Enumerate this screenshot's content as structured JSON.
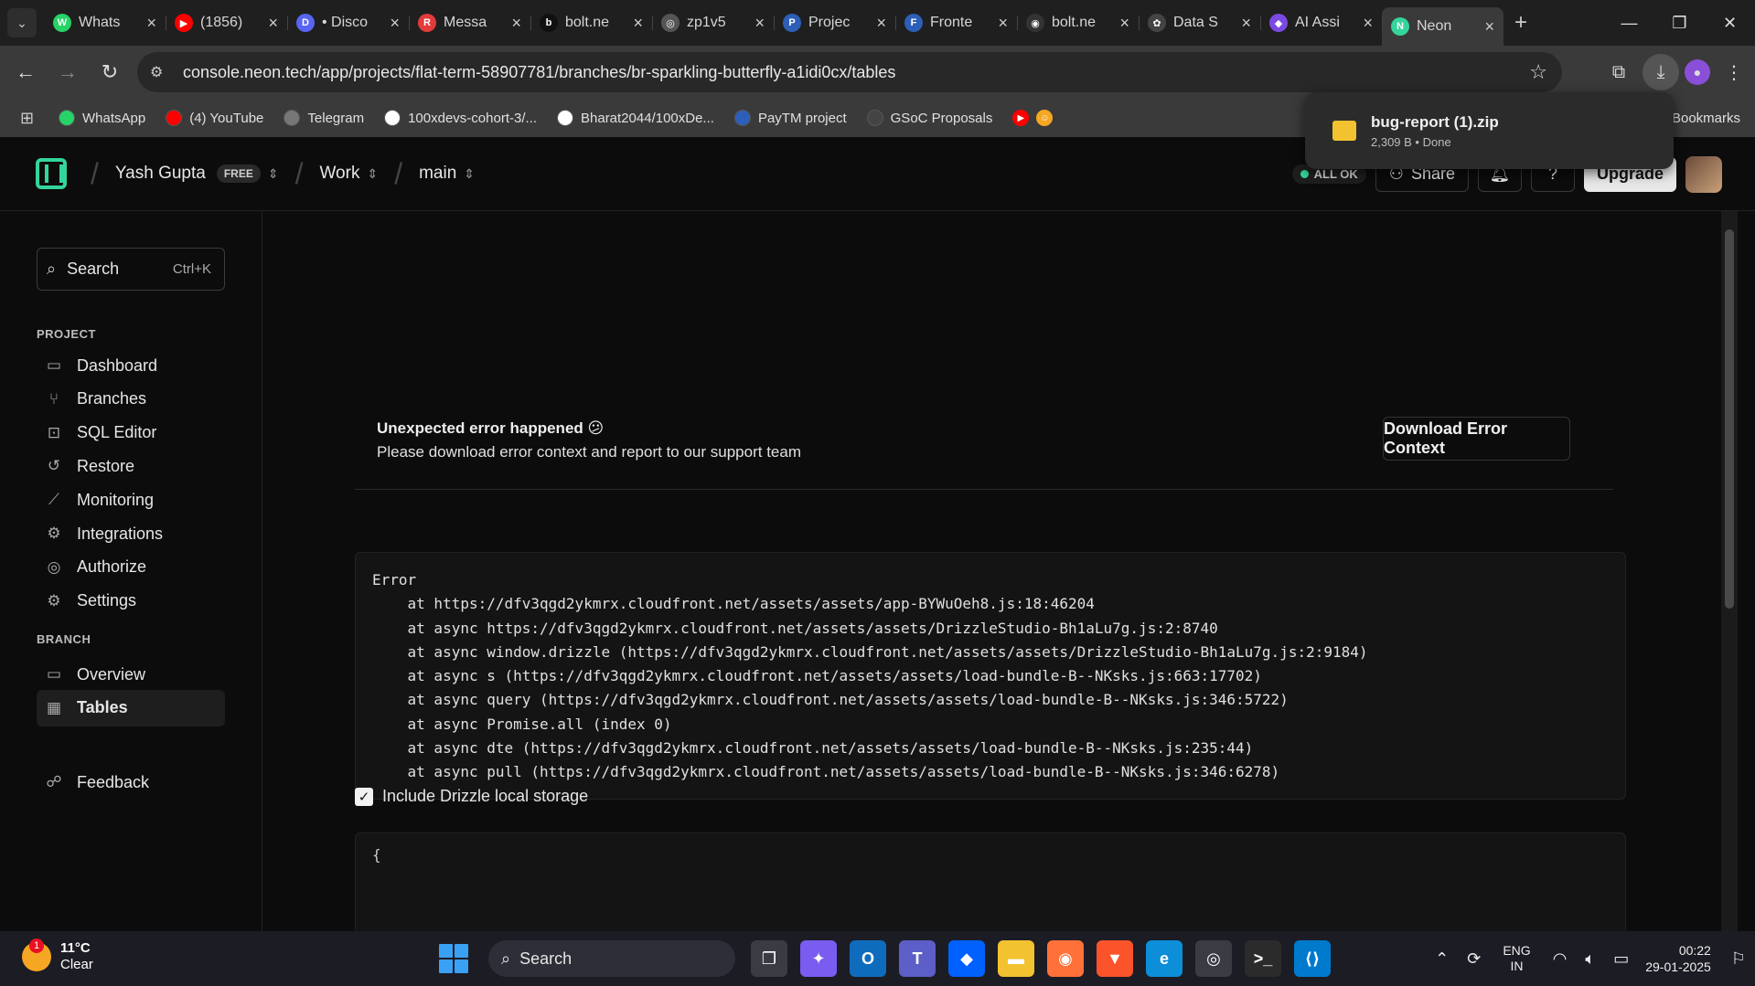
{
  "browser": {
    "tabs": [
      {
        "label": "Whats",
        "color": "#25d366",
        "glyph": "W"
      },
      {
        "label": "(1856)",
        "color": "#ff0000",
        "glyph": "▶"
      },
      {
        "label": "• Disco",
        "color": "#5865f2",
        "glyph": "D"
      },
      {
        "label": "Messa",
        "color": "#e23b3b",
        "glyph": "R"
      },
      {
        "label": "bolt.ne",
        "color": "#111111",
        "glyph": "b"
      },
      {
        "label": "zp1v5",
        "color": "#555555",
        "glyph": "◎"
      },
      {
        "label": "Projec",
        "color": "#2d5fb8",
        "glyph": "P"
      },
      {
        "label": "Fronte",
        "color": "#2d5fb8",
        "glyph": "F"
      },
      {
        "label": "bolt.ne",
        "color": "#333333",
        "glyph": "◉"
      },
      {
        "label": "Data S",
        "color": "#444444",
        "glyph": "✿"
      },
      {
        "label": "AI Assi",
        "color": "#7b4ae2",
        "glyph": "◆"
      },
      {
        "label": "Neon",
        "color": "#34d59a",
        "glyph": "N"
      }
    ],
    "url": "console.neon.tech/app/projects/flat-term-58907781/branches/br-sparkling-butterfly-a1idi0cx/tables",
    "bookmarks": [
      {
        "label": "WhatsApp",
        "color": "#25d366"
      },
      {
        "label": "(4) YouTube",
        "color": "#ff0000"
      },
      {
        "label": "Telegram",
        "color": "#777777"
      },
      {
        "label": "100xdevs-cohort-3/...",
        "color": "#ffffff"
      },
      {
        "label": "Bharat2044/100xDe...",
        "color": "#ffffff"
      },
      {
        "label": "PayTM project",
        "color": "#2d5fb8"
      },
      {
        "label": "GSoC Proposals",
        "color": "#444444"
      }
    ],
    "bookmarks_all": "Bookmarks",
    "download": {
      "filename": "bug-report (1).zip",
      "meta": "2,309 B • Done"
    }
  },
  "header": {
    "user": "Yash Gupta",
    "plan": "FREE",
    "project": "Work",
    "branch": "main",
    "status": "ALL OK",
    "share": "Share",
    "upgrade": "Upgrade"
  },
  "sidebar": {
    "search_label": "Search",
    "search_shortcut": "Ctrl+K",
    "project_label": "PROJECT",
    "project_items": [
      {
        "label": "Dashboard",
        "icon": "▭"
      },
      {
        "label": "Branches",
        "icon": "⑂"
      },
      {
        "label": "SQL Editor",
        "icon": "⊡"
      },
      {
        "label": "Restore",
        "icon": "↺"
      },
      {
        "label": "Monitoring",
        "icon": "⟋"
      },
      {
        "label": "Integrations",
        "icon": "⚙"
      },
      {
        "label": "Authorize",
        "icon": "◎"
      },
      {
        "label": "Settings",
        "icon": "⚙"
      }
    ],
    "branch_label": "BRANCH",
    "branch_items": [
      {
        "label": "Overview",
        "icon": "▭"
      },
      {
        "label": "Tables",
        "icon": "▦"
      }
    ],
    "feedback": "Feedback"
  },
  "main": {
    "error_title": "Unexpected error happened 😕",
    "error_subtitle": "Please download error context and report to our support team",
    "download_button": "Download Error Context",
    "stack": [
      "Error",
      "    at https://dfv3qgd2ykmrx.cloudfront.net/assets/assets/app-BYWuOeh8.js:18:46204",
      "    at async https://dfv3qgd2ykmrx.cloudfront.net/assets/assets/DrizzleStudio-Bh1aLu7g.js:2:8740",
      "    at async window.drizzle (https://dfv3qgd2ykmrx.cloudfront.net/assets/assets/DrizzleStudio-Bh1aLu7g.js:2:9184)",
      "    at async s (https://dfv3qgd2ykmrx.cloudfront.net/assets/assets/load-bundle-B--NKsks.js:663:17702)",
      "    at async query (https://dfv3qgd2ykmrx.cloudfront.net/assets/assets/load-bundle-B--NKsks.js:346:5722)",
      "    at async Promise.all (index 0)",
      "    at async dte (https://dfv3qgd2ykmrx.cloudfront.net/assets/assets/load-bundle-B--NKsks.js:235:44)",
      "    at async pull (https://dfv3qgd2ykmrx.cloudfront.net/assets/assets/load-bundle-B--NKsks.js:346:6278)"
    ],
    "include_storage_label": "Include Drizzle local storage",
    "storage_preview": "{"
  },
  "taskbar": {
    "temperature": "11°C",
    "weather": "Clear",
    "search": "Search",
    "language": "ENG",
    "region": "IN",
    "time": "00:22",
    "date": "29-01-2025"
  }
}
